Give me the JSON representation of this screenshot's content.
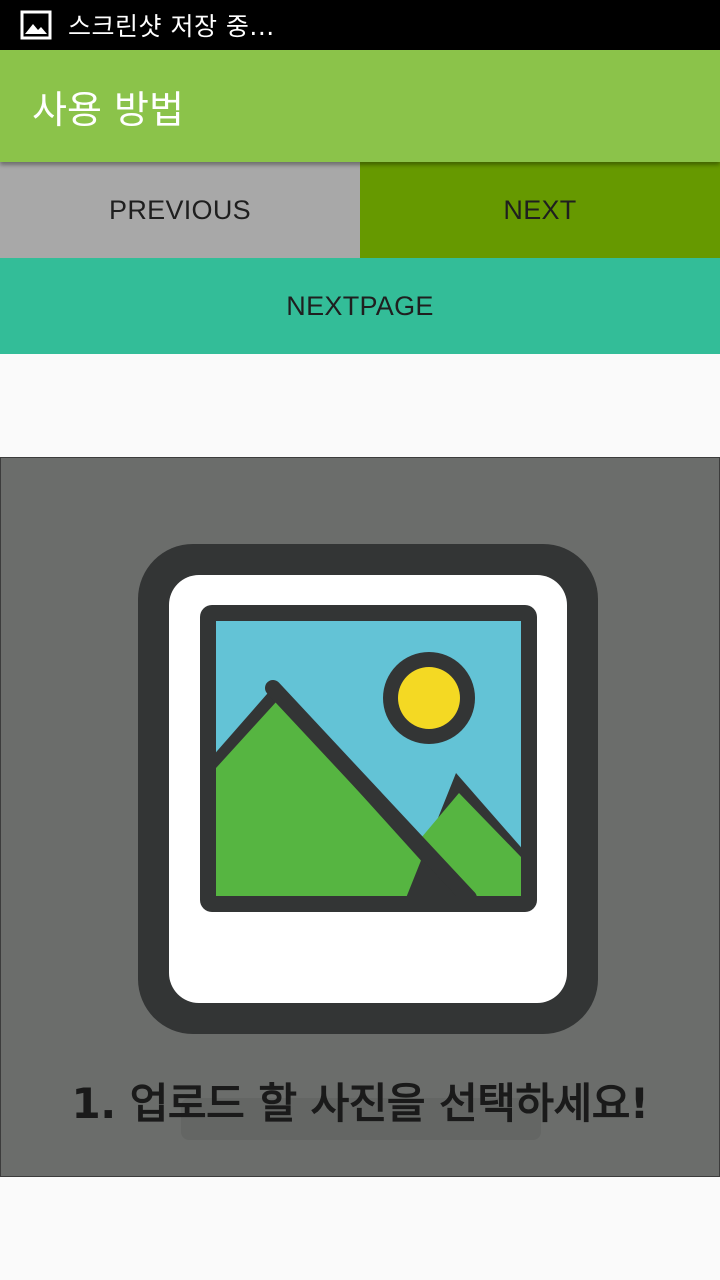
{
  "status_bar": {
    "notification_icon": "image-icon",
    "notification_text": "스크린샷 저장 중..."
  },
  "app_bar": {
    "title": "사용 방법",
    "color": "#8bc34a"
  },
  "buttons": {
    "previous": "PREVIOUS",
    "next": "NEXT",
    "next_page": "NEXTPAGE"
  },
  "tutorial": {
    "illustration_icon": "picture-icon",
    "caption": "1. 업로드 할 사진을 선택하세요!"
  }
}
